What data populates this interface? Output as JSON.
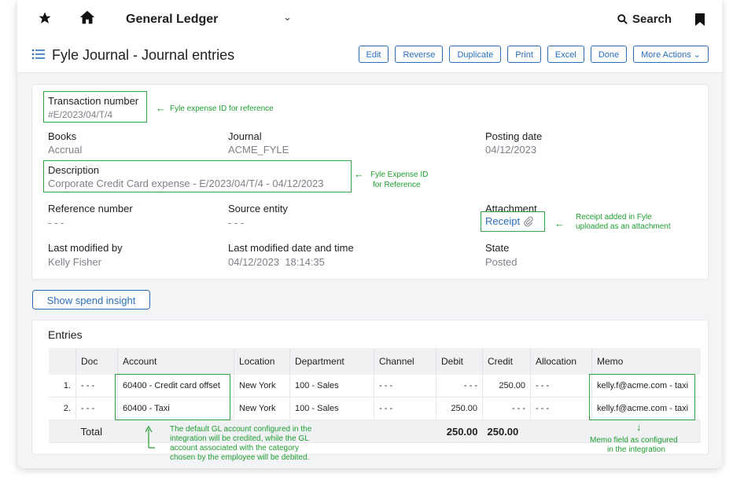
{
  "topnav": {
    "app_title": "General Ledger",
    "search_label": "Search"
  },
  "page": {
    "title": "Fyle Journal - Journal entries",
    "actions": [
      "Edit",
      "Reverse",
      "Duplicate",
      "Print",
      "Excel",
      "Done",
      "More Actions"
    ]
  },
  "fields": {
    "transaction_number": {
      "label": "Transaction number",
      "value": "#E/2023/04/T/4"
    },
    "books": {
      "label": "Books",
      "value": "Accrual"
    },
    "journal": {
      "label": "Journal",
      "value": "ACME_FYLE"
    },
    "posting_date": {
      "label": "Posting date",
      "value": "04/12/2023"
    },
    "description": {
      "label": "Description",
      "value": "Corporate Credit Card expense - E/2023/04/T/4 - 04/12/2023"
    },
    "reference_number": {
      "label": "Reference number",
      "value": "- - -"
    },
    "source_entity": {
      "label": "Source entity",
      "value": "- - -"
    },
    "attachment": {
      "label": "Attachment",
      "value": "Receipt"
    },
    "last_modified_by": {
      "label": "Last modified by",
      "value": "Kelly Fisher"
    },
    "last_modified_dt": {
      "label": "Last modified date and time",
      "value": "04/12/2023  18:14:35"
    },
    "state": {
      "label": "State",
      "value": "Posted"
    }
  },
  "spend_insight_label": "Show spend insight",
  "entries": {
    "title": "Entries",
    "columns": [
      "",
      "Doc",
      "Account",
      "Location",
      "Department",
      "Channel",
      "Debit",
      "Credit",
      "Allocation",
      "Memo"
    ],
    "rows": [
      [
        "1.",
        "- - -",
        "60400 - Credit card offset",
        "New York",
        "100 - Sales",
        "- - -",
        "- - -",
        "250.00",
        "- - -",
        "kelly.f@acme.com - taxi"
      ],
      [
        "2.",
        "- - -",
        "60400 - Taxi",
        "New York",
        "100 - Sales",
        "- - -",
        "250.00",
        "- - -",
        "- - -",
        "kelly.f@acme.com - taxi"
      ]
    ],
    "total": {
      "label": "Total",
      "debit": "250.00",
      "credit": "250.00"
    }
  },
  "annotations": {
    "transaction": "Fyle expense ID for reference",
    "description_1": "Fyle Expense ID",
    "description_2": "for Reference",
    "receipt_1": "Receipt added in Fyle",
    "receipt_2": "uploaded as an attachment",
    "gl_1": "The default GL account configured in the",
    "gl_2": "integration will be credited, while the GL",
    "gl_3": "account associated with the category",
    "gl_4": "chosen by the employee will be debited.",
    "memo_1": "Memo field as configured",
    "memo_2": "in the integration"
  },
  "colors": {
    "accent": "#2a6ebb",
    "annotation": "#1e9e2f"
  }
}
